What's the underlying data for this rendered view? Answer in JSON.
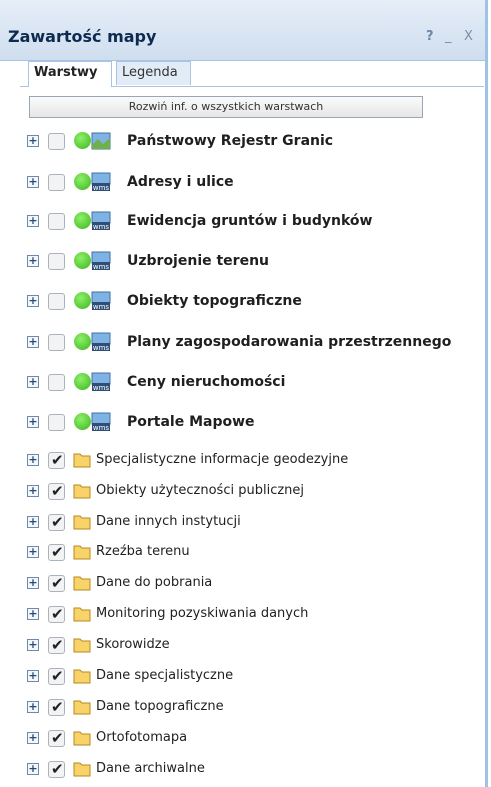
{
  "window": {
    "title": "Zawartość mapy",
    "controls": {
      "help": "?",
      "minimize": "_",
      "close": "X"
    }
  },
  "tabs": [
    {
      "label": "Warstwy",
      "active": true
    },
    {
      "label": "Legenda",
      "active": false
    }
  ],
  "expand_all_label": "Rozwiń inf. o wszystkich warstwach",
  "layer_groups": [
    {
      "label": "Państwowy Rejestr Granic",
      "checked": false,
      "status": "green",
      "icon": "map-icon"
    },
    {
      "label": "Adresy i ulice",
      "checked": false,
      "status": "green",
      "icon": "wms-icon"
    },
    {
      "label": "Ewidencja gruntów i budynków",
      "checked": false,
      "status": "green",
      "icon": "wms-icon"
    },
    {
      "label": "Uzbrojenie terenu",
      "checked": false,
      "status": "green",
      "icon": "wms-icon"
    },
    {
      "label": "Obiekty topograficzne",
      "checked": false,
      "status": "green",
      "icon": "wms-icon"
    },
    {
      "label": "Plany zagospodarowania przestrzennego",
      "checked": false,
      "status": "green",
      "icon": "wms-icon"
    },
    {
      "label": "Ceny nieruchomości",
      "checked": false,
      "status": "green",
      "icon": "wms-icon"
    },
    {
      "label": "Portale Mapowe",
      "checked": false,
      "status": "green",
      "icon": "wms-icon"
    }
  ],
  "folders": [
    {
      "label": "Specjalistyczne informacje geodezyjne",
      "checked": true,
      "icon": "folder-icon"
    },
    {
      "label": "Obiekty użyteczności publicznej",
      "checked": true,
      "icon": "folder-icon"
    },
    {
      "label": "Dane innych instytucji",
      "checked": true,
      "icon": "folder-icon"
    },
    {
      "label": "Rzeźba terenu",
      "checked": true,
      "icon": "folder-icon"
    },
    {
      "label": "Dane do pobrania",
      "checked": true,
      "icon": "folder-icon"
    },
    {
      "label": "Monitoring pozyskiwania danych",
      "checked": true,
      "icon": "folder-icon"
    },
    {
      "label": "Skorowidze",
      "checked": true,
      "icon": "folder-icon"
    },
    {
      "label": "Dane specjalistyczne",
      "checked": true,
      "icon": "folder-icon"
    },
    {
      "label": "Dane topograficzne",
      "checked": true,
      "icon": "folder-icon"
    },
    {
      "label": "Ortofotomapa",
      "checked": true,
      "icon": "folder-icon"
    },
    {
      "label": "Dane archiwalne",
      "checked": true,
      "icon": "folder-icon"
    }
  ]
}
